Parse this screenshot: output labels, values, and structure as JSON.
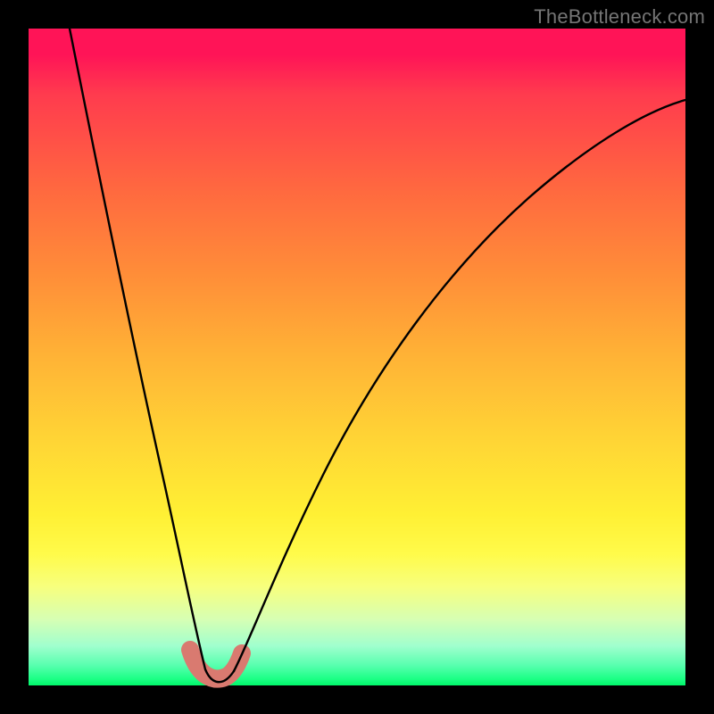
{
  "watermark": "TheBottleneck.com",
  "chart_data": {
    "type": "line",
    "title": "",
    "xlabel": "",
    "ylabel": "",
    "xlim": [
      0,
      100
    ],
    "ylim": [
      0,
      100
    ],
    "grid": false,
    "legend": false,
    "annotations": [],
    "series": [
      {
        "name": "bottleneck-curve",
        "x": [
          0,
          4,
          8,
          12,
          16,
          20,
          24,
          26,
          28,
          30,
          32,
          36,
          40,
          46,
          54,
          64,
          76,
          88,
          100
        ],
        "y": [
          100,
          82,
          64,
          47,
          31,
          17,
          6,
          2,
          0,
          0,
          2,
          12,
          25,
          40,
          54,
          66,
          76,
          83,
          88
        ]
      }
    ],
    "marker_region": {
      "name": "min-region",
      "x": [
        24.5,
        26,
        28,
        30,
        31.5
      ],
      "y": [
        4,
        1.5,
        0,
        1,
        3
      ]
    },
    "colors": {
      "curve": "#000000",
      "marker": "#d97a70",
      "gradient_top": "#ff1457",
      "gradient_bottom": "#00f56a"
    }
  }
}
